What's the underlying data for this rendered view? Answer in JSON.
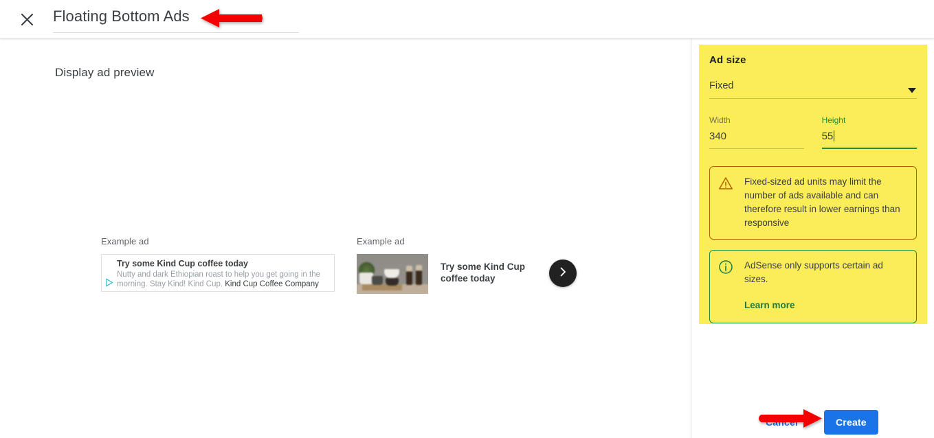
{
  "header": {
    "close_icon": "close-icon",
    "title_value": "Floating Bottom Ads"
  },
  "preview": {
    "heading": "Display ad preview",
    "example_ads": [
      {
        "label": "Example ad",
        "type": "text-ad",
        "headline": "Try some Kind Cup coffee today",
        "body": "Nutty and dark Ethiopian roast to help you get going in the",
        "body2": "morning. Stay Kind! Kind Cup. ",
        "advertiser": "Kind Cup Coffee Company",
        "adchoices_icon": "adchoices-icon"
      },
      {
        "label": "Example ad",
        "type": "image-ad",
        "headline": "Try some Kind Cup coffee today",
        "image_alt": "coffee-pour-over-photo",
        "next_icon": "chevron-right-icon"
      }
    ]
  },
  "settings": {
    "panel_title": "Ad size",
    "size_mode": {
      "value": "Fixed",
      "chevron_icon": "chevron-down-icon"
    },
    "width": {
      "label": "Width",
      "value": "340"
    },
    "height": {
      "label": "Height",
      "value": "55",
      "focused": true
    },
    "notices": [
      {
        "icon": "warning-triangle-icon",
        "text": "Fixed-sized ad units may limit the number of ads available and can therefore result in lower earnings than responsive"
      },
      {
        "icon": "info-circle-icon",
        "text": "AdSense only supports certain ad sizes.",
        "link": "Learn more"
      }
    ],
    "cancel_label": "Cancel",
    "create_label": "Create"
  },
  "annotations": [
    {
      "name": "arrow-pointing-to-title",
      "direction": "left",
      "color": "#f40000"
    },
    {
      "name": "arrow-pointing-to-create-button",
      "direction": "right",
      "color": "#f40000"
    }
  ],
  "colors": {
    "highlight_panel": "#faed57",
    "primary_button": "#1a73e8",
    "link": "#1a73e8",
    "focus_green": "#1e8e3e",
    "warning_border": "#b06000",
    "annotation_red": "#f40000"
  }
}
